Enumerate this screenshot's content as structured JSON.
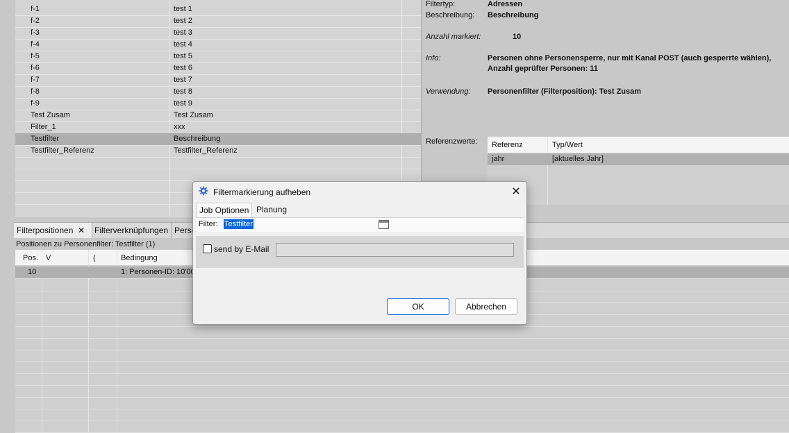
{
  "filters": [
    {
      "name": "f-1",
      "desc": "test 1"
    },
    {
      "name": "f-2",
      "desc": "test 2"
    },
    {
      "name": "f-3",
      "desc": "test 3"
    },
    {
      "name": "f-4",
      "desc": "test 4"
    },
    {
      "name": "f-5",
      "desc": "test 5"
    },
    {
      "name": "f-6",
      "desc": "test 6"
    },
    {
      "name": "f-7",
      "desc": "test 7"
    },
    {
      "name": "f-8",
      "desc": "test 8"
    },
    {
      "name": "f-9",
      "desc": "test 9"
    },
    {
      "name": "Test Zusam",
      "desc": "Test Zusam"
    },
    {
      "name": "Filter_1",
      "desc": "xxx"
    },
    {
      "name": "Testfilter",
      "desc": "Beschreibung"
    },
    {
      "name": "Testfilter_Referenz",
      "desc": "Testfilter_Referenz"
    }
  ],
  "details": {
    "filtertyp_label": "Filtertyp:",
    "filtertyp_value": "Adressen",
    "beschreibung_label": "Beschreibung:",
    "beschreibung_value": "Beschreibung",
    "anzahl_label": "Anzahl markiert:",
    "anzahl_value": "10",
    "info_label": "Info:",
    "info_line1": "Personen ohne Personensperre, nur mit Kanal POST (auch gesperrte wählen),",
    "info_line2": "Anzahl geprüfter Personen: 11",
    "verwendung_label": "Verwendung:",
    "verwendung_value": "Personenfilter (Filterposition): Test Zusam",
    "referenzwerte_label": "Referenzwerte:",
    "ref_header_ref": "Referenz",
    "ref_header_typ": "Typ/Wert",
    "ref_row_ref": "jahr",
    "ref_row_typ": "[aktuelles Jahr]"
  },
  "lower": {
    "tab1": "Filterpositionen",
    "tab2": "Filterverknüpfungen",
    "tab3": "Perso",
    "caption": "Positionen zu Personenfilter: Testfilter (1)",
    "col_pos": "Pos.",
    "col_v": "V",
    "col_paren": "(",
    "col_bedingung": "Bedingung",
    "row_pos": "10",
    "row_bedingung": "1: Personen-ID: 10'00"
  },
  "dialog": {
    "title": "Filtermarkierung aufheben",
    "tab_job": "Job Optionen",
    "tab_planung": "Planung",
    "filter_label": "Filter:",
    "filter_value": "Testfilter",
    "email_label": "send by E-Mail",
    "ok": "OK",
    "cancel": "Abbrechen",
    "close_glyph": "✕"
  },
  "icons": {
    "gear_color": "#3a6fd8"
  }
}
